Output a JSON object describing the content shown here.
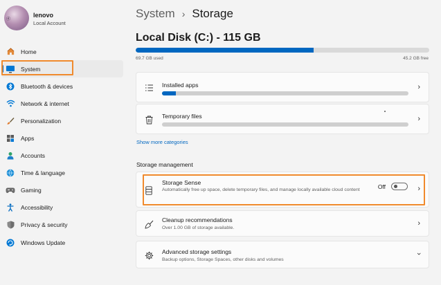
{
  "profile": {
    "name": "lenovo",
    "account_type": "Local Account"
  },
  "nav": {
    "items": [
      {
        "key": "home",
        "label": "Home",
        "icon": "home-icon"
      },
      {
        "key": "system",
        "label": "System",
        "icon": "display-icon",
        "selected": true
      },
      {
        "key": "bluetooth",
        "label": "Bluetooth & devices",
        "icon": "bluetooth-icon"
      },
      {
        "key": "network",
        "label": "Network & internet",
        "icon": "wifi-icon"
      },
      {
        "key": "personalization",
        "label": "Personalization",
        "icon": "brush-icon"
      },
      {
        "key": "apps",
        "label": "Apps",
        "icon": "apps-icon"
      },
      {
        "key": "accounts",
        "label": "Accounts",
        "icon": "person-icon"
      },
      {
        "key": "time",
        "label": "Time & language",
        "icon": "globe-clock-icon"
      },
      {
        "key": "gaming",
        "label": "Gaming",
        "icon": "gamepad-icon"
      },
      {
        "key": "accessibility",
        "label": "Accessibility",
        "icon": "accessibility-icon"
      },
      {
        "key": "privacy",
        "label": "Privacy & security",
        "icon": "shield-icon"
      },
      {
        "key": "update",
        "label": "Windows Update",
        "icon": "update-icon"
      }
    ]
  },
  "breadcrumb": {
    "parent": "System",
    "separator": "›",
    "current": "Storage"
  },
  "disk": {
    "title": "Local Disk (C:) - 115 GB",
    "used_label": "69.7 GB used",
    "free_label": "45.2 GB free",
    "used_fraction": 0.606
  },
  "categories": [
    {
      "label": "Installed apps",
      "fill_fraction": 0.055
    },
    {
      "label": "Temporary files",
      "fill_fraction": 0.0
    }
  ],
  "show_more": "Show more categories",
  "storage_management": {
    "heading": "Storage management",
    "storage_sense": {
      "title": "Storage Sense",
      "description": "Automatically free up space, delete temporary files, and manage locally available cloud content",
      "toggle_label": "Off",
      "toggle_on": false
    },
    "cleanup": {
      "title": "Cleanup recommendations",
      "description": "Over 1.00 GB of storage available."
    },
    "advanced": {
      "title": "Advanced storage settings",
      "description": "Backup options, Storage Spaces, other disks and volumes"
    }
  },
  "colors": {
    "accent": "#0067c0",
    "highlight": "#f08a2c",
    "background": "#f3f3f3"
  }
}
